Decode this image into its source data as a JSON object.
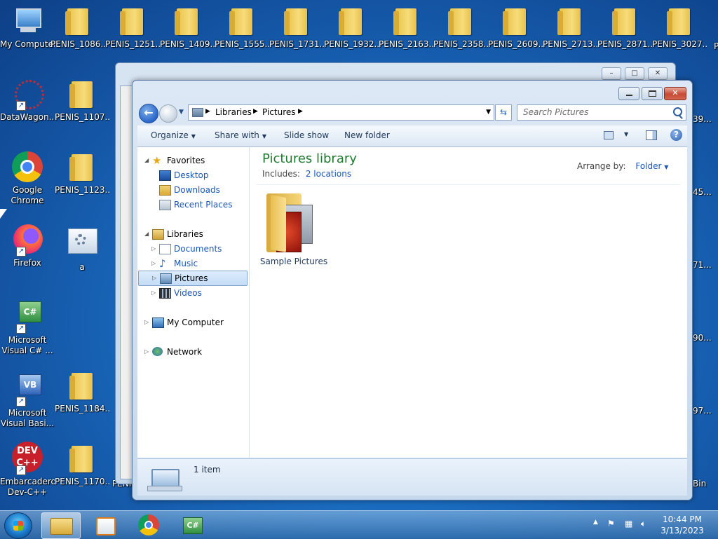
{
  "desktop": {
    "top_icons": [
      {
        "label": "My Computer",
        "icon": "computer-icon"
      },
      {
        "label": "PENIS_1086...",
        "icon": "folder-icon"
      },
      {
        "label": "PENIS_1251...",
        "icon": "folder-icon"
      },
      {
        "label": "PENIS_1409...",
        "icon": "folder-icon"
      },
      {
        "label": "PENIS_1555...",
        "icon": "folder-icon"
      },
      {
        "label": "PENIS_1731...",
        "icon": "folder-icon"
      },
      {
        "label": "PENIS_1932...",
        "icon": "folder-icon"
      },
      {
        "label": "PENIS_2163...",
        "icon": "folder-icon"
      },
      {
        "label": "PENIS_2358...",
        "icon": "folder-icon"
      },
      {
        "label": "PENIS_2609...",
        "icon": "folder-icon"
      },
      {
        "label": "PENIS_2713...",
        "icon": "folder-icon"
      },
      {
        "label": "PENIS_2871...",
        "icon": "folder-icon"
      },
      {
        "label": "PENIS_3027...",
        "icon": "folder-icon"
      }
    ],
    "left_col1": [
      {
        "label": "DataWagon...",
        "icon": "datawagon-icon"
      },
      {
        "label": "Google Chrome",
        "icon": "chrome-icon"
      },
      {
        "label": "Firefox",
        "icon": "firefox-icon"
      },
      {
        "label": "Microsoft Visual C# ...",
        "icon": "visual-csharp-icon"
      },
      {
        "label": "Microsoft Visual Basi...",
        "icon": "visual-basic-icon"
      },
      {
        "label": "Embarcadero Dev-C++",
        "icon": "devcpp-icon"
      }
    ],
    "left_col2": [
      {
        "label": "PENIS_1107...",
        "icon": "folder-icon"
      },
      {
        "label": "PENIS_1123...",
        "icon": "folder-icon"
      },
      {
        "label": "a",
        "icon": "settings-file-icon"
      },
      {
        "label": "PENIS_1184...",
        "icon": "folder-icon"
      },
      {
        "label": "PENIS_1170...",
        "icon": "folder-icon"
      }
    ],
    "partial_right_labels": [
      "39...",
      "45...",
      "71...",
      "90...",
      "97...",
      "Bin"
    ],
    "partial_p_label": "P",
    "partial_penis_label": "PENIS"
  },
  "explorer": {
    "breadcrumb": [
      "Libraries",
      "Pictures"
    ],
    "search_placeholder": "Search Pictures",
    "commands": {
      "organize": "Organize",
      "share_with": "Share with",
      "slide_show": "Slide show",
      "new_folder": "New folder"
    },
    "nav": {
      "favorites": "Favorites",
      "desktop": "Desktop",
      "downloads": "Downloads",
      "recent_places": "Recent Places",
      "libraries": "Libraries",
      "documents": "Documents",
      "music": "Music",
      "pictures": "Pictures",
      "videos": "Videos",
      "my_computer": "My Computer",
      "network": "Network"
    },
    "library_title": "Pictures library",
    "includes_label": "Includes:",
    "includes_link": "2 locations",
    "arrange_by_label": "Arrange by:",
    "arrange_by_value": "Folder",
    "items": [
      {
        "label": "Sample Pictures",
        "icon": "sample-pictures-folder-icon"
      }
    ],
    "status_text": "1 item"
  },
  "taskbar": {
    "time": "10:44 PM",
    "date": "3/13/2023"
  },
  "colors": {
    "title_green": "#1e7a2e",
    "link_blue": "#1a56b6"
  }
}
